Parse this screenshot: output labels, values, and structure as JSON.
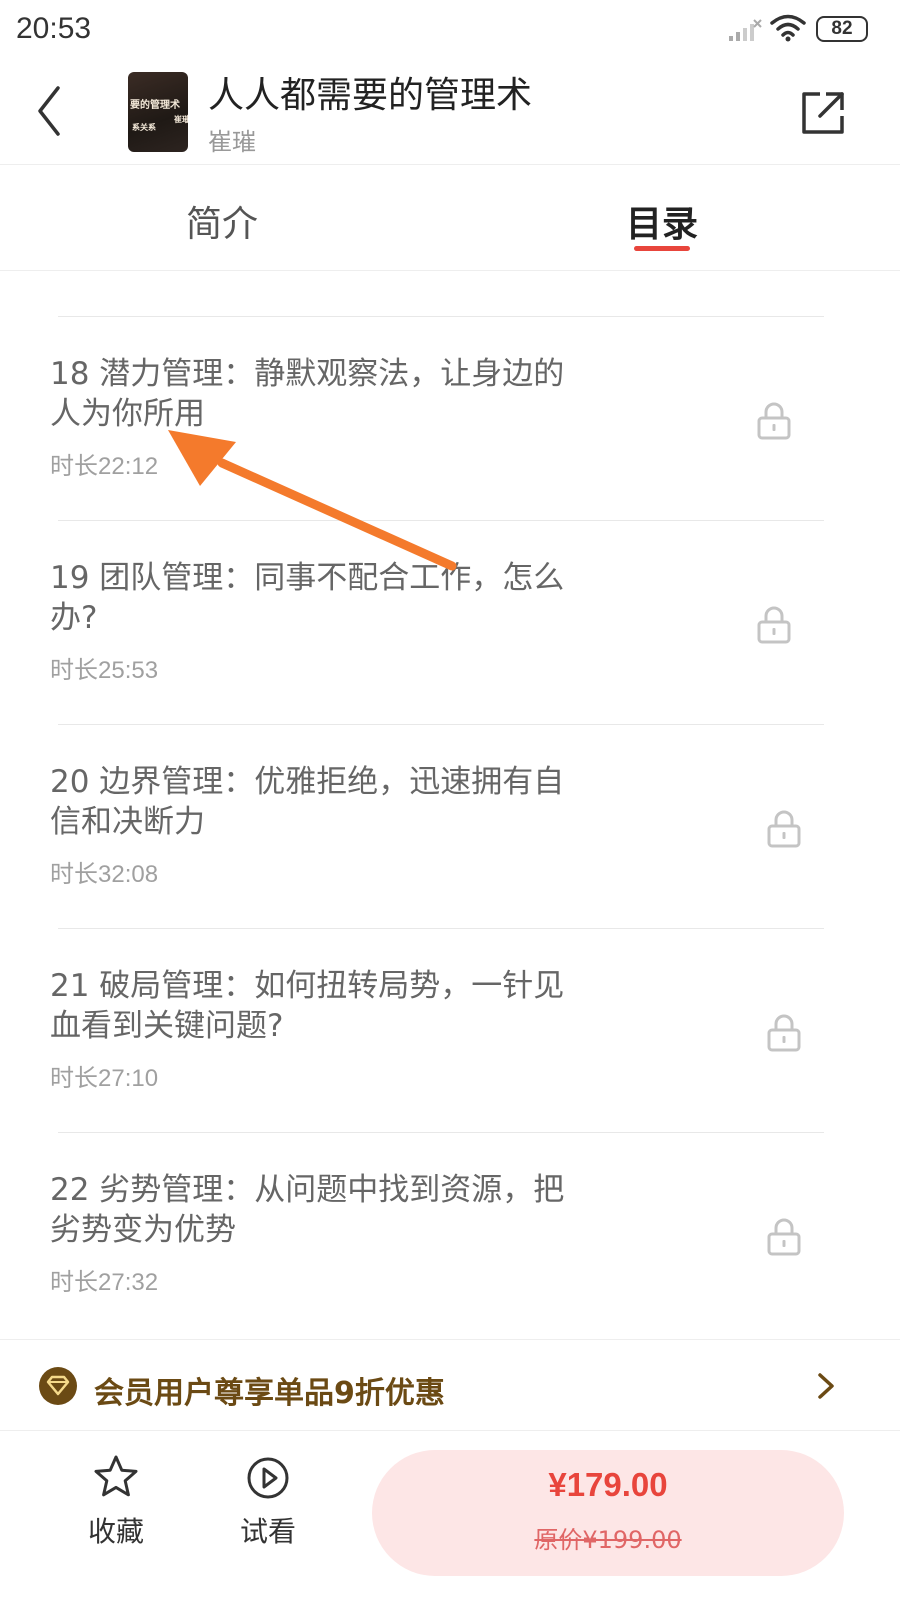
{
  "status_bar": {
    "time": "20:53",
    "battery": "82",
    "icons": [
      "signal-icon",
      "wifi-icon",
      "battery-icon"
    ]
  },
  "header": {
    "title": "人人都需要的管理术",
    "author": "崔璀",
    "cover_lines": [
      "要的管理术",
      "崔璀",
      "系关系"
    ],
    "icons": [
      "back-arrow-icon",
      "share-icon"
    ]
  },
  "tabs": [
    {
      "label": "简介",
      "active": false
    },
    {
      "label": "目录",
      "active": true
    }
  ],
  "chapters": [
    {
      "title": "18 潜力管理：静默观察法，让身边的人为你所用",
      "duration": "时长22:12",
      "locked": true
    },
    {
      "title": "19 团队管理：同事不配合工作，怎么办?",
      "duration": "时长25:53",
      "locked": true
    },
    {
      "title": "20 边界管理：优雅拒绝，迅速拥有自信和决断力",
      "duration": "时长32:08",
      "locked": true
    },
    {
      "title": "21 破局管理：如何扭转局势，一针见血看到关键问题?",
      "duration": "时长27:10",
      "locked": true
    },
    {
      "title": "22 劣势管理：从问题中找到资源，把劣势变为优势",
      "duration": "时长27:32",
      "locked": true
    }
  ],
  "member_banner": {
    "text": "会员用户尊享单品9折优惠",
    "icon": "vip-diamond-icon"
  },
  "bottom_bar": {
    "favorite_label": "收藏",
    "preview_label": "试看",
    "price": "¥179.00",
    "original_price": "原价¥199.00"
  },
  "colors": {
    "accent": "#e8453c",
    "member_gold": "#6b4a14",
    "buy_bg": "#fde6e6",
    "annotation_arrow": "#f47a2c"
  }
}
